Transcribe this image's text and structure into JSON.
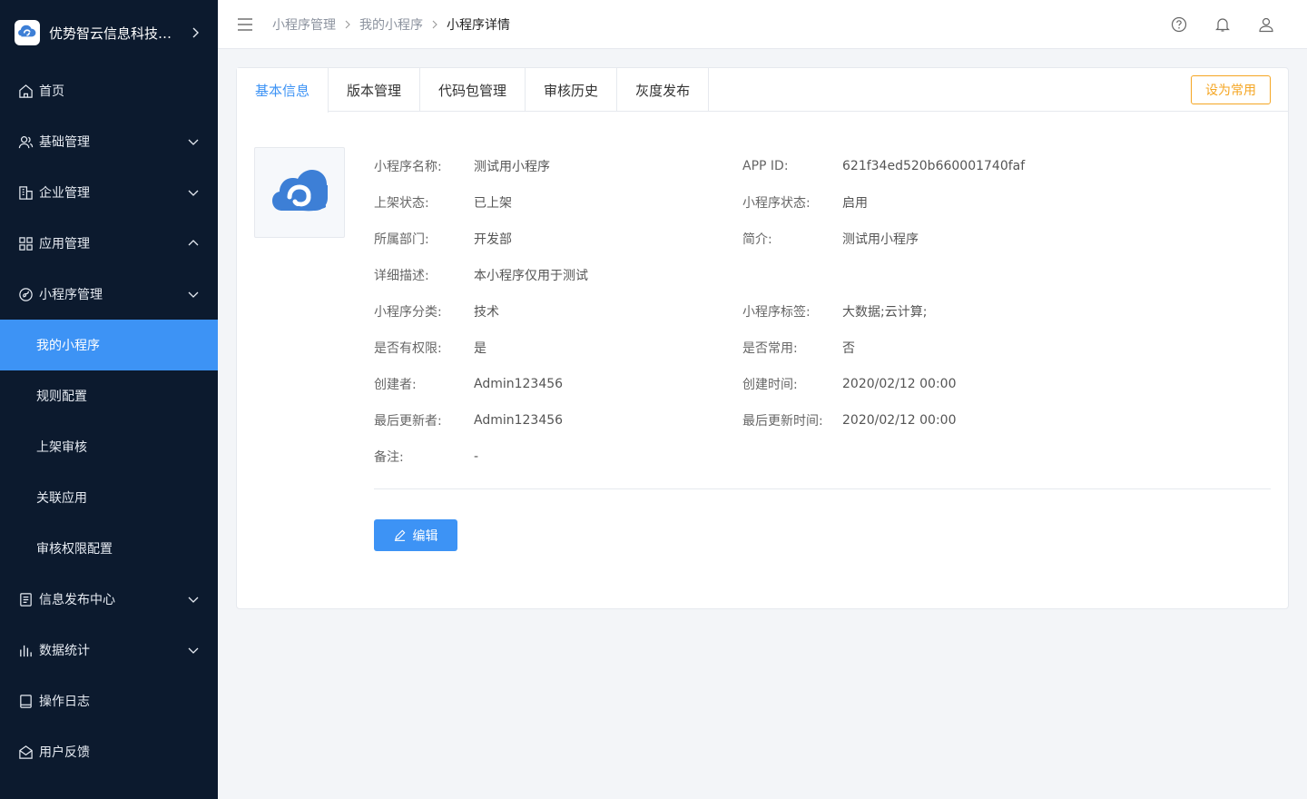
{
  "brand": {
    "name": "优势智云信息科技有限公司"
  },
  "sidebar": {
    "items": [
      {
        "label": "首页",
        "icon": "home-icon"
      },
      {
        "label": "基础管理",
        "icon": "users-icon",
        "chevron": "down"
      },
      {
        "label": "企业管理",
        "icon": "building-icon",
        "chevron": "down"
      },
      {
        "label": "应用管理",
        "icon": "grid-icon",
        "chevron": "up"
      },
      {
        "label": "小程序管理",
        "icon": "miniapp-icon",
        "chevron": "down"
      }
    ],
    "sub_items": [
      {
        "label": "我的小程序",
        "active": true
      },
      {
        "label": "规则配置"
      },
      {
        "label": "上架审核"
      },
      {
        "label": "关联应用"
      },
      {
        "label": "审核权限配置"
      }
    ],
    "bottom_items": [
      {
        "label": "信息发布中心",
        "icon": "document-icon",
        "chevron": "down"
      },
      {
        "label": "数据统计",
        "icon": "bar-chart-icon",
        "chevron": "down"
      },
      {
        "label": "操作日志",
        "icon": "log-book-icon"
      },
      {
        "label": "用户反馈",
        "icon": "feedback-icon"
      }
    ]
  },
  "breadcrumb": {
    "items": [
      "小程序管理",
      "我的小程序",
      "小程序详情"
    ]
  },
  "tabs": [
    "基本信息",
    "版本管理",
    "代码包管理",
    "审核历史",
    "灰度发布"
  ],
  "fav_button": "设为常用",
  "info_rows": [
    [
      {
        "label": "小程序名称:",
        "value": "测试用小程序"
      },
      {
        "label": "APP ID:",
        "value": "621f34ed520b660001740faf"
      }
    ],
    [
      {
        "label": "上架状态:",
        "value": "已上架"
      },
      {
        "label": "小程序状态:",
        "value": "启用"
      }
    ],
    [
      {
        "label": "所属部门:",
        "value": "开发部"
      },
      {
        "label": "简介:",
        "value": "测试用小程序"
      }
    ],
    [
      {
        "label": "详细描述:",
        "value": "本小程序仅用于测试"
      }
    ],
    [
      {
        "label": "小程序分类:",
        "value": "技术"
      },
      {
        "label": "小程序标签:",
        "value": "大数据;云计算;"
      }
    ],
    [
      {
        "label": "是否有权限:",
        "value": "是"
      },
      {
        "label": "是否常用:",
        "value": "否"
      }
    ],
    [
      {
        "label": "创建者:",
        "value": "Admin123456"
      },
      {
        "label": "创建时间:",
        "value": "2020/02/12 00:00"
      }
    ],
    [
      {
        "label": "最后更新者:",
        "value": "Admin123456"
      },
      {
        "label": "最后更新时间:",
        "value": "2020/02/12 00:00"
      }
    ],
    [
      {
        "label": "备注:",
        "value": "-"
      }
    ]
  ],
  "edit_button": "编辑",
  "colors": {
    "sidebar_bg": "#0c1a2e",
    "accent": "#3d93f5",
    "warning": "#f5a623"
  }
}
